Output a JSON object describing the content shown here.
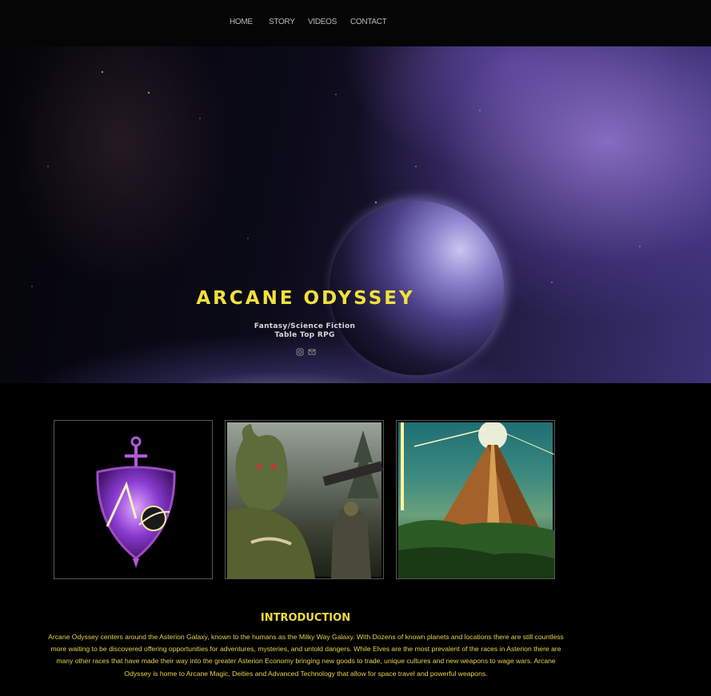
{
  "nav": {
    "items": [
      {
        "label": "HOME"
      },
      {
        "label": "STORY"
      },
      {
        "label": "VIDEOS"
      },
      {
        "label": "CONTACT"
      }
    ]
  },
  "hero": {
    "title": "ARCANE ODYSSEY",
    "subtitle_line1": "Fantasy/Science Fiction",
    "subtitle_line2": "Table Top RPG",
    "social_icons": [
      "instagram-icon",
      "mail-icon"
    ]
  },
  "gallery": {
    "images": [
      {
        "name": "arcane-odyssey-emblem"
      },
      {
        "name": "orc-warrior-artwork"
      },
      {
        "name": "pyramid-artwork"
      }
    ]
  },
  "intro": {
    "title": "INTRODUCTION",
    "body": "Arcane Odyssey centers around the Asterion Galaxy, known to the humans as the Milky Way Galaxy. With Dozens of known planets and locations there are still countless more waiting to be discovered offering opportunities for adventures, mysteries, and untold dangers. While Elves are the most prevalent of the races in Asterion there are many other races that have made their way into the greater Asterion Economy bringing new goods to trade, unique cultures and new weapons to wage wars. Arcane Odyssey is home to Arcane Magic, Deities and Advanced Technology that allow for space travel and powerful weapons."
  },
  "colors": {
    "accent": "#f2e13a",
    "background": "#000000",
    "nav_text": "#b8b8b8"
  }
}
